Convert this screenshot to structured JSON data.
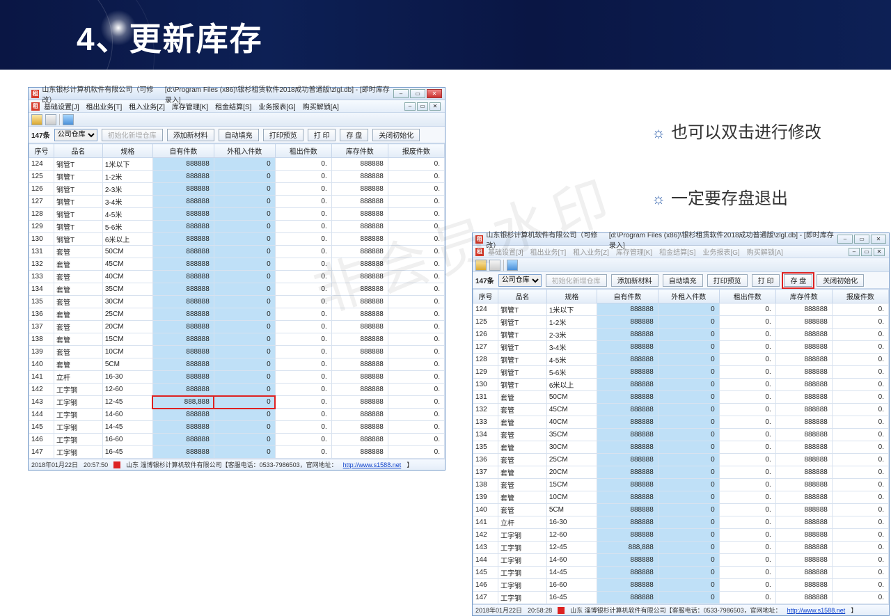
{
  "slide": {
    "title": "4、更新库存"
  },
  "notes": {
    "a": "也可以双击进行修改",
    "b": "一定要存盘退出"
  },
  "watermark": "非会员水印",
  "app": {
    "title_prefix": "山东银杉计算机软件有限公司（可修改）",
    "title_path": "[d:\\Program Files (x86)\\银杉租赁软件2018成功普通版\\zlgl.db] - [即时库存录入]",
    "menu": [
      "基础设置[J]",
      "租出业务[T]",
      "租入业务[Z]",
      "库存管理[K]",
      "租金结算[S]",
      "业务报表[G]",
      "购买解锁[A]"
    ],
    "count": "147条",
    "warehouse": "公司仓库",
    "buttons": {
      "init": "初始化新增仓库",
      "add": "添加新材料",
      "autofill": "自动填充",
      "preview": "打印预览",
      "print": "打 印",
      "save": "存 盘",
      "close": "关闭初始化"
    },
    "cols": [
      "序号",
      "品名",
      "规格",
      "自有件数",
      "外租入件数",
      "租出件数",
      "库存件数",
      "报废件数"
    ],
    "status": {
      "date": "2018年01月22日",
      "time1": "20:57:50",
      "time2": "20:58:28",
      "company": "山东 淄博银杉计算机软件有限公司【客服电话：0533-7986503，官网地址：",
      "url": "http://www.s1588.net",
      "tail": "】"
    }
  },
  "rows": [
    {
      "n": "124",
      "p": "钢管T",
      "g": "1米以下",
      "a": "888888",
      "b": "0",
      "c": "0.",
      "d": "888888",
      "e": "0."
    },
    {
      "n": "125",
      "p": "钢管T",
      "g": "1-2米",
      "a": "888888",
      "b": "0",
      "c": "0.",
      "d": "888888",
      "e": "0."
    },
    {
      "n": "126",
      "p": "钢管T",
      "g": "2-3米",
      "a": "888888",
      "b": "0",
      "c": "0.",
      "d": "888888",
      "e": "0."
    },
    {
      "n": "127",
      "p": "钢管T",
      "g": "3-4米",
      "a": "888888",
      "b": "0",
      "c": "0.",
      "d": "888888",
      "e": "0."
    },
    {
      "n": "128",
      "p": "钢管T",
      "g": "4-5米",
      "a": "888888",
      "b": "0",
      "c": "0.",
      "d": "888888",
      "e": "0."
    },
    {
      "n": "129",
      "p": "钢管T",
      "g": "5-6米",
      "a": "888888",
      "b": "0",
      "c": "0.",
      "d": "888888",
      "e": "0."
    },
    {
      "n": "130",
      "p": "钢管T",
      "g": "6米以上",
      "a": "888888",
      "b": "0",
      "c": "0.",
      "d": "888888",
      "e": "0."
    },
    {
      "n": "131",
      "p": "套管",
      "g": "50CM",
      "a": "888888",
      "b": "0",
      "c": "0.",
      "d": "888888",
      "e": "0."
    },
    {
      "n": "132",
      "p": "套管",
      "g": "45CM",
      "a": "888888",
      "b": "0",
      "c": "0.",
      "d": "888888",
      "e": "0."
    },
    {
      "n": "133",
      "p": "套管",
      "g": "40CM",
      "a": "888888",
      "b": "0",
      "c": "0.",
      "d": "888888",
      "e": "0."
    },
    {
      "n": "134",
      "p": "套管",
      "g": "35CM",
      "a": "888888",
      "b": "0",
      "c": "0.",
      "d": "888888",
      "e": "0."
    },
    {
      "n": "135",
      "p": "套管",
      "g": "30CM",
      "a": "888888",
      "b": "0",
      "c": "0.",
      "d": "888888",
      "e": "0."
    },
    {
      "n": "136",
      "p": "套管",
      "g": "25CM",
      "a": "888888",
      "b": "0",
      "c": "0.",
      "d": "888888",
      "e": "0."
    },
    {
      "n": "137",
      "p": "套管",
      "g": "20CM",
      "a": "888888",
      "b": "0",
      "c": "0.",
      "d": "888888",
      "e": "0."
    },
    {
      "n": "138",
      "p": "套管",
      "g": "15CM",
      "a": "888888",
      "b": "0",
      "c": "0.",
      "d": "888888",
      "e": "0."
    },
    {
      "n": "139",
      "p": "套管",
      "g": "10CM",
      "a": "888888",
      "b": "0",
      "c": "0.",
      "d": "888888",
      "e": "0."
    },
    {
      "n": "140",
      "p": "套管",
      "g": "5CM",
      "a": "888888",
      "b": "0",
      "c": "0.",
      "d": "888888",
      "e": "0."
    },
    {
      "n": "141",
      "p": "立杆",
      "g": "16-30",
      "a": "888888",
      "b": "0",
      "c": "0.",
      "d": "888888",
      "e": "0."
    },
    {
      "n": "142",
      "p": "工字钢",
      "g": "12-60",
      "a": "888888",
      "b": "0",
      "c": "0.",
      "d": "888888",
      "e": "0."
    },
    {
      "n": "143",
      "p": "工字钢",
      "g": "12-45",
      "a": "888,888",
      "b": "0",
      "c": "0.",
      "d": "888888",
      "e": "0."
    },
    {
      "n": "144",
      "p": "工字钢",
      "g": "14-60",
      "a": "888888",
      "b": "0",
      "c": "0.",
      "d": "888888",
      "e": "0."
    },
    {
      "n": "145",
      "p": "工字钢",
      "g": "14-45",
      "a": "888888",
      "b": "0",
      "c": "0.",
      "d": "888888",
      "e": "0."
    },
    {
      "n": "146",
      "p": "工字钢",
      "g": "16-60",
      "a": "888888",
      "b": "0",
      "c": "0.",
      "d": "888888",
      "e": "0."
    },
    {
      "n": "147",
      "p": "工字钢",
      "g": "16-45",
      "a": "888888",
      "b": "0",
      "c": "0.",
      "d": "888888",
      "e": "0."
    }
  ]
}
